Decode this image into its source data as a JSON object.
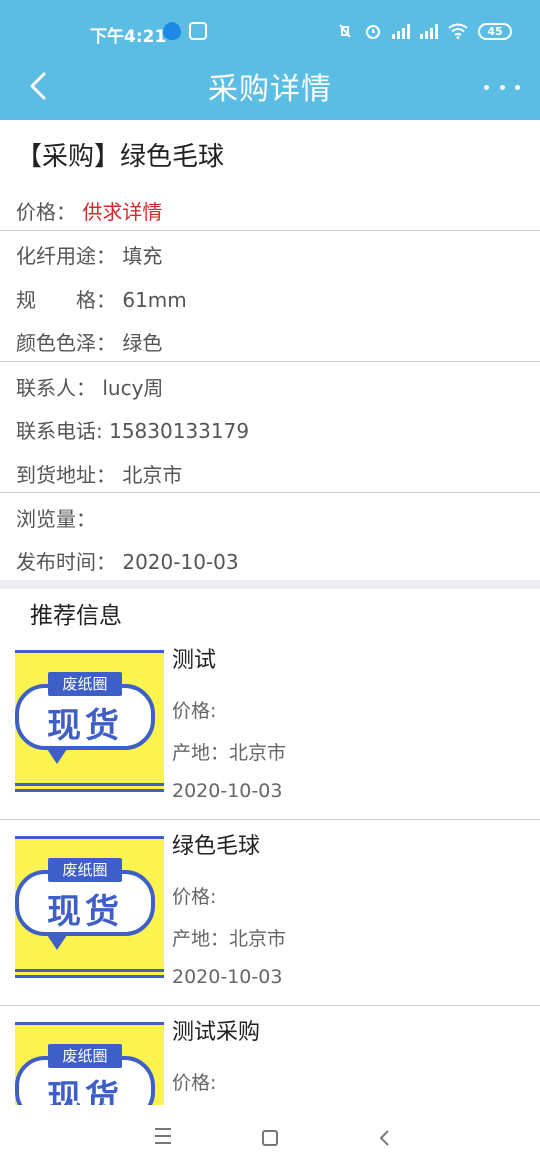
{
  "status_bar": {
    "time": "下午4:21",
    "battery": "45"
  },
  "nav": {
    "title": "采购详情"
  },
  "detail": {
    "title": "【采购】绿色毛球",
    "price_label": "价格：",
    "price_value": "供求详情",
    "usage_label": "化纤用途：",
    "usage_value": "填充",
    "spec_label": "规　　格：",
    "spec_value": "61mm",
    "color_label": "颜色色泽：",
    "color_value": "绿色",
    "contact_label": "联系人：",
    "contact_value": "lucy周",
    "phone_label": "联系电话: ",
    "phone_value": "15830133179",
    "address_label": "到货地址：",
    "address_value": "北京市",
    "views_label": "浏览量：",
    "views_value": "",
    "publish_label": "发布时间：",
    "publish_value": "2020-10-03"
  },
  "recommend": {
    "title": "推荐信息",
    "thumb_badge": "废纸圈",
    "thumb_big": "现货",
    "items": [
      {
        "name": "测试",
        "price": "价格:",
        "origin": "产地：北京市",
        "date": "2020-10-03"
      },
      {
        "name": "绿色毛球",
        "price": "价格:",
        "origin": "产地：北京市",
        "date": "2020-10-03"
      },
      {
        "name": "测试采购",
        "price": "价格:",
        "origin": "",
        "date": ""
      }
    ]
  },
  "colors": {
    "header": "#5bbde4",
    "price_link": "#d22b2b",
    "thumb_bg": "#fbf34f",
    "thumb_blue": "#3f5fc8"
  }
}
